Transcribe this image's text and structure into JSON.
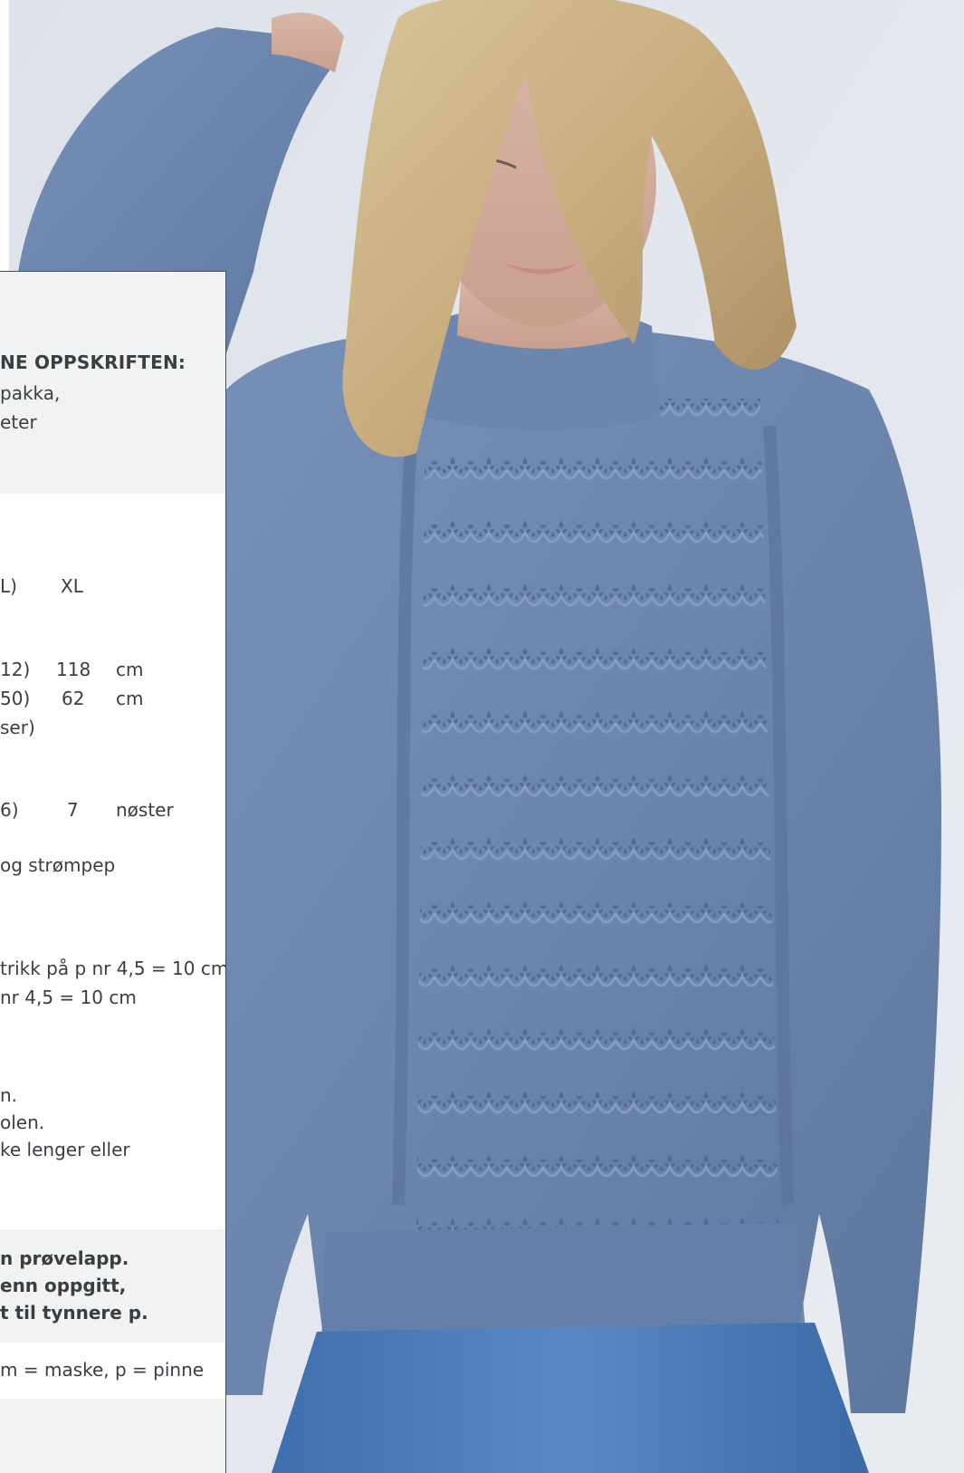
{
  "panel": {
    "header_title": "NE OPPSKRIFTEN:",
    "header_line_1": "pakka,",
    "header_line_2": "eter",
    "sizes": {
      "size_label_1": "L)",
      "size_label_2": "XL"
    },
    "measure_1": {
      "prev": "12)",
      "val": "118",
      "unit": "cm"
    },
    "measure_2": {
      "prev": "50)",
      "val": "62",
      "unit": "cm"
    },
    "measure_note": "ser)",
    "yarn": {
      "prev": "6)",
      "val": "7",
      "unit": "nøster"
    },
    "needles": "og strømpep",
    "gauge_1": "trikk på p nr 4,5 = 10 cm",
    "gauge_2": "nr 4,5 = 10 cm",
    "notes": [
      "n.",
      "olen.",
      "ke lenger eller"
    ],
    "tip": [
      "n prøvelapp.",
      "enn oppgitt,",
      "t til tynnere p."
    ],
    "abbreviations": "m = maske, p = pinne"
  },
  "colors": {
    "sweater": "#6d86ad",
    "background": "#e3e7ed",
    "panel_gray": "#f1f3f2",
    "text": "#3a3d44"
  }
}
